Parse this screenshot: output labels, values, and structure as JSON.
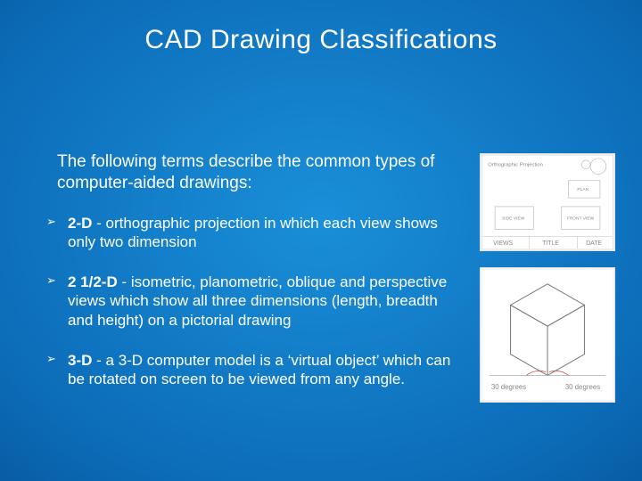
{
  "title": "CAD Drawing Classifications",
  "intro": "The following terms describe the common types of computer-aided drawings:",
  "bullets": [
    {
      "term": "2-D",
      "rest": " - orthographic projection in which each view shows only two dimension"
    },
    {
      "term": "2 1/2-D",
      "rest": " - isometric, planometric, oblique and perspective views which show all three dimensions (length, breadth and height) on a pictorial drawing"
    },
    {
      "term": "3-D",
      "rest": " - a 3-D computer model is a ‘virtual object’ which can be rotated on screen to be viewed from any angle."
    }
  ],
  "fig1_labels": {
    "box1": "SIDE VIEW",
    "box2": "FRONT VIEW",
    "bottom1": "VIEWS",
    "bottom2": "TITLE",
    "bottom3": "DATE",
    "top": "Orthographic Projection",
    "plan": "PLAN"
  },
  "fig2_labels": {
    "left": "30 degrees",
    "right": "30 degrees"
  }
}
